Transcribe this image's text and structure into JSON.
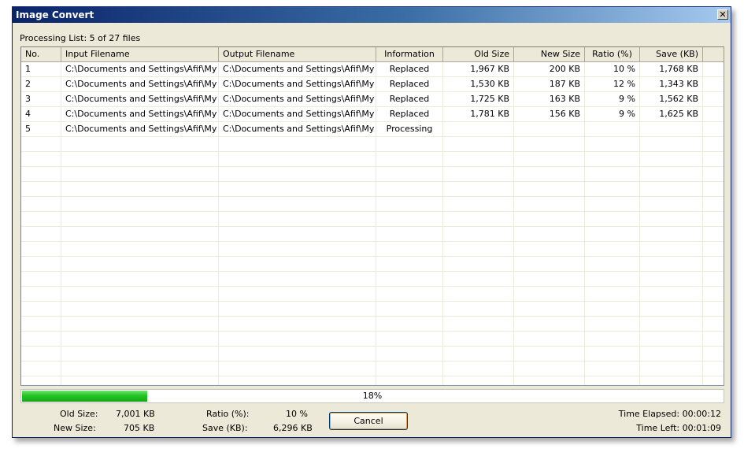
{
  "window": {
    "title": "Image Convert",
    "close_glyph": "✕"
  },
  "processing_label": "Processing List: 5 of 27 files",
  "table": {
    "columns": [
      "No.",
      "Input Filename",
      "Output Filename",
      "Information",
      "Old Size",
      "New Size",
      "Ratio (%)",
      "Save (KB)"
    ],
    "rows": [
      [
        "1",
        "C:\\Documents and Settings\\Afif\\My ...",
        "C:\\Documents and Settings\\Afif\\My ...",
        "Replaced",
        "1,967 KB",
        "200 KB",
        "10 %",
        "1,768 KB"
      ],
      [
        "2",
        "C:\\Documents and Settings\\Afif\\My ...",
        "C:\\Documents and Settings\\Afif\\My ...",
        "Replaced",
        "1,530 KB",
        "187 KB",
        "12 %",
        "1,343 KB"
      ],
      [
        "3",
        "C:\\Documents and Settings\\Afif\\My ...",
        "C:\\Documents and Settings\\Afif\\My ...",
        "Replaced",
        "1,725 KB",
        "163 KB",
        "9 %",
        "1,562 KB"
      ],
      [
        "4",
        "C:\\Documents and Settings\\Afif\\My ...",
        "C:\\Documents and Settings\\Afif\\My ...",
        "Replaced",
        "1,781 KB",
        "156 KB",
        "9 %",
        "1,625 KB"
      ],
      [
        "5",
        "C:\\Documents and Settings\\Afif\\My ...",
        "C:\\Documents and Settings\\Afif\\My ...",
        "Processing",
        "",
        "",
        "",
        ""
      ]
    ]
  },
  "progress": {
    "percent": 18,
    "label": "18%",
    "color": "#23c423"
  },
  "stats": {
    "old_size_label": "Old Size:",
    "old_size_value": "7,001 KB",
    "new_size_label": "New Size:",
    "new_size_value": "705 KB",
    "ratio_label": "Ratio (%):",
    "ratio_value": "10 %",
    "save_label": "Save (KB):",
    "save_value": "6,296 KB",
    "time_elapsed": "Time Elapsed: 00:00:12",
    "time_left": "Time Left: 00:01:09"
  },
  "buttons": {
    "cancel_label": "Cancel"
  }
}
